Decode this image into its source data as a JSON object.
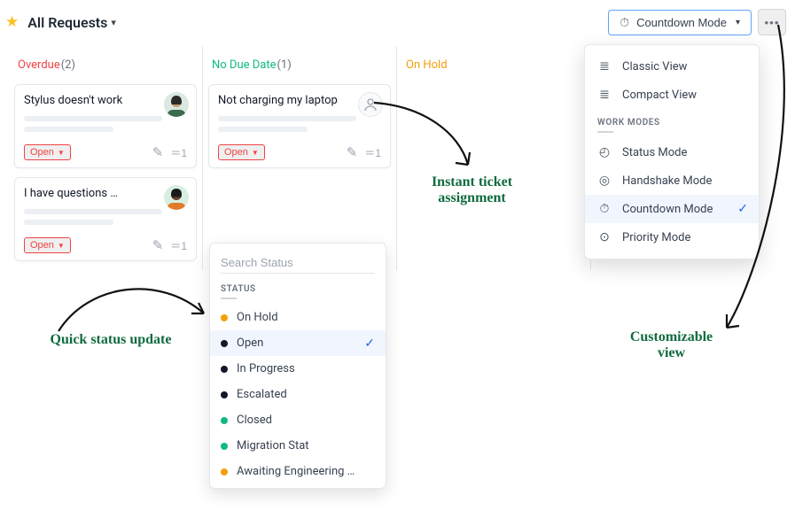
{
  "header": {
    "title": "All Requests",
    "countdown_button": "Countdown Mode"
  },
  "columns": {
    "overdue": {
      "label": "Overdue",
      "count": "(2)"
    },
    "nodue": {
      "label": "No Due Date",
      "count": "(1)"
    },
    "onhold": {
      "label": "On Hold"
    }
  },
  "cards": {
    "c1": {
      "title": "Stylus doesn't work",
      "status": "Open",
      "cnt": "1"
    },
    "c2": {
      "title": "I have questions …",
      "status": "Open",
      "cnt": "1"
    },
    "c3": {
      "title": "Not charging my laptop",
      "status": "Open",
      "cnt": "1"
    }
  },
  "status_popup": {
    "placeholder": "Search Status",
    "section": "STATUS",
    "items": [
      {
        "label": "On Hold",
        "color": "#f59e0b",
        "selected": false
      },
      {
        "label": "Open",
        "color": "#111827",
        "selected": true
      },
      {
        "label": "In Progress",
        "color": "#111827",
        "selected": false
      },
      {
        "label": "Escalated",
        "color": "#111827",
        "selected": false
      },
      {
        "label": "Closed",
        "color": "#10b981",
        "selected": false
      },
      {
        "label": "Migration Stat",
        "color": "#10b981",
        "selected": false
      },
      {
        "label": "Awaiting Engineering R...",
        "color": "#f59e0b",
        "selected": false
      }
    ]
  },
  "view_popup": {
    "views": [
      {
        "label": "Classic View"
      },
      {
        "label": "Compact View"
      }
    ],
    "section": "WORK MODES",
    "modes": [
      {
        "label": "Status Mode",
        "icon": "status"
      },
      {
        "label": "Handshake Mode",
        "icon": "handshake"
      },
      {
        "label": "Countdown Mode",
        "icon": "countdown",
        "selected": true
      },
      {
        "label": "Priority Mode",
        "icon": "priority"
      }
    ]
  },
  "annotations": {
    "quick": "Quick status update",
    "instant": "Instant ticket assignment",
    "custom": "Customizable view"
  },
  "colors": {
    "accent": "#2563eb"
  }
}
